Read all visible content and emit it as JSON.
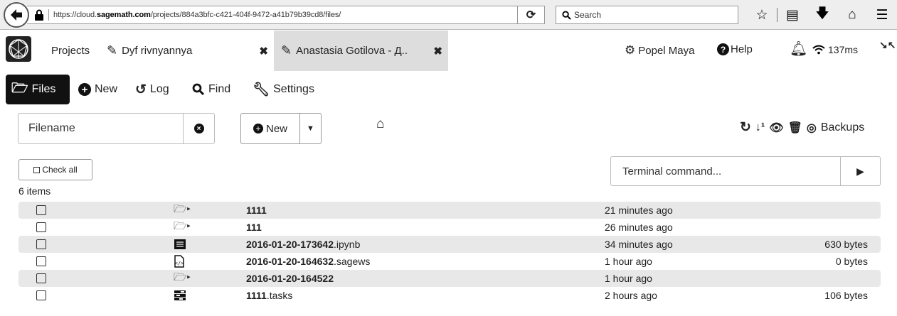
{
  "browser": {
    "url_prefix": "https://cloud.",
    "url_host": "sagemath.com",
    "url_path": "/projects/884a3bfc-c421-404f-9472-a41b79b39cd8/files/",
    "search_placeholder": "Search"
  },
  "app": {
    "tabs": {
      "projects_label": "Projects",
      "dyf_label": "Dyf rivnyannya",
      "anastasia_label": "Anastasia Gotilova - Д..",
      "close_glyph": "✖"
    },
    "user_label": "Popel Maya",
    "help_label": "Help",
    "latency": "137ms"
  },
  "subnav": {
    "files": "Files",
    "new": "New",
    "log": "Log",
    "find": "Find",
    "settings": "Settings"
  },
  "toolbar": {
    "filename_placeholder": "Filename",
    "new_label": "New",
    "backups_label": "Backups"
  },
  "listing": {
    "check_all_label": "Check all",
    "items_count": "6 items",
    "terminal_placeholder": "Terminal command...",
    "rows": [
      {
        "type": "folder",
        "icon": "folder-open-icon",
        "base": "1111",
        "ext": "",
        "time": "21 minutes ago",
        "size": ""
      },
      {
        "type": "folder",
        "icon": "folder-open-icon",
        "base": "111",
        "ext": "",
        "time": "26 minutes ago",
        "size": ""
      },
      {
        "type": "file",
        "icon": "notebook-icon",
        "base": "2016-01-20-173642",
        "ext": ".ipynb",
        "time": "34 minutes ago",
        "size": "630 bytes"
      },
      {
        "type": "file",
        "icon": "code-file-icon",
        "base": "2016-01-20-164632",
        "ext": ".sagews",
        "time": "1 hour ago",
        "size": "0 bytes"
      },
      {
        "type": "folder",
        "icon": "folder-open-icon",
        "base": "2016-01-20-164522",
        "ext": "",
        "time": "1 hour ago",
        "size": ""
      },
      {
        "type": "file",
        "icon": "tasks-icon",
        "base": "1111",
        "ext": ".tasks",
        "time": "2 hours ago",
        "size": "106 bytes"
      }
    ]
  }
}
